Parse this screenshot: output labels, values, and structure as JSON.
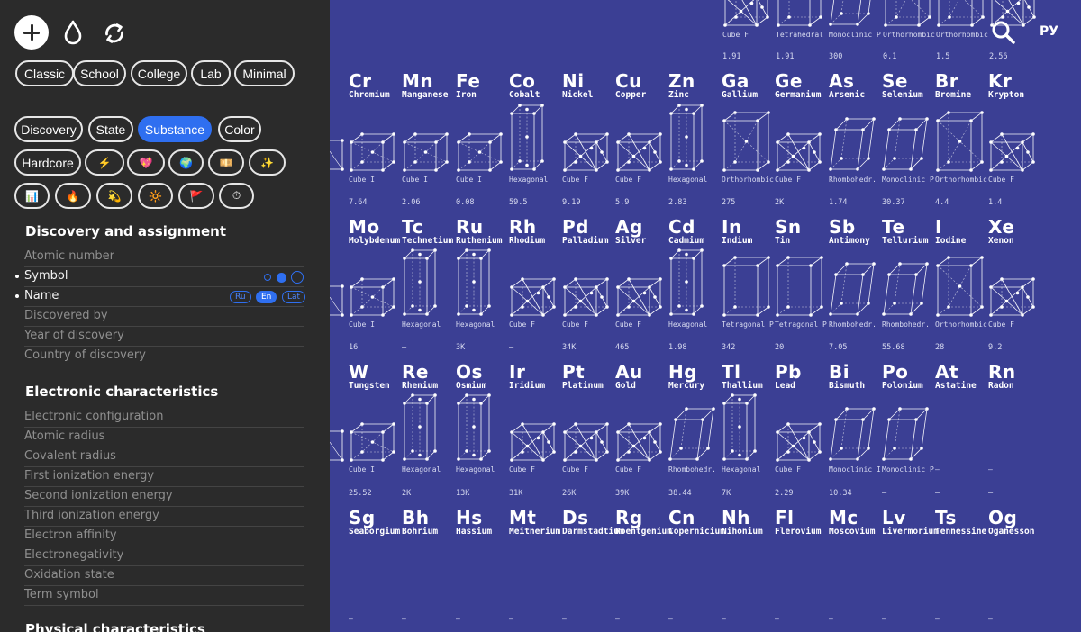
{
  "header": {
    "lang_toggle": "РУ"
  },
  "sidebar": {
    "presets": [
      {
        "label": "Classic",
        "active": false
      },
      {
        "label": "School",
        "active": false
      },
      {
        "label": "College",
        "active": false
      },
      {
        "label": "Lab",
        "active": false
      },
      {
        "label": "Minimal",
        "active": false
      },
      {
        "label": "Discovery",
        "active": false
      },
      {
        "label": "State",
        "active": false
      },
      {
        "label": "Substance",
        "active": true
      },
      {
        "label": "Color",
        "active": false
      },
      {
        "label": "Hardcore",
        "active": false
      },
      {
        "label": "⚡",
        "active": false
      },
      {
        "label": "💖",
        "active": false
      },
      {
        "label": "🌍",
        "active": false
      },
      {
        "label": "💴",
        "active": false
      },
      {
        "label": "✨",
        "active": false
      },
      {
        "label": "📊",
        "active": false
      },
      {
        "label": "🔥",
        "active": false
      },
      {
        "label": "💫",
        "active": false
      },
      {
        "label": "🔆",
        "active": false
      },
      {
        "label": "🚩",
        "active": false
      },
      {
        "label": "⏱",
        "active": false
      }
    ],
    "sections": [
      {
        "title": "Discovery and assignment",
        "options": [
          {
            "label": "Atomic number",
            "on": false
          },
          {
            "label": "Symbol",
            "on": true
          },
          {
            "label": "Name",
            "on": true
          },
          {
            "label": "Discovered by",
            "on": false
          },
          {
            "label": "Year of discovery",
            "on": false
          },
          {
            "label": "Country of discovery",
            "on": false
          }
        ]
      },
      {
        "title": "Electronic characteristics",
        "options": [
          {
            "label": "Electronic configuration",
            "on": false
          },
          {
            "label": "Atomic radius",
            "on": false
          },
          {
            "label": "Covalent radius",
            "on": false
          },
          {
            "label": "First ionization energy",
            "on": false
          },
          {
            "label": "Second ionization energy",
            "on": false
          },
          {
            "label": "Third ionization energy",
            "on": false
          },
          {
            "label": "Electron affinity",
            "on": false
          },
          {
            "label": "Electronegativity",
            "on": false
          },
          {
            "label": "Oxidation state",
            "on": false
          },
          {
            "label": "Term symbol",
            "on": false
          }
        ]
      },
      {
        "title": "Physical characteristics",
        "options": []
      }
    ],
    "name_langs": [
      {
        "label": "Ru",
        "active": false
      },
      {
        "label": "En",
        "active": true
      },
      {
        "label": "Lat",
        "active": false
      }
    ]
  },
  "table": {
    "row0": {
      "structures": [
        "Cube F",
        "Tetrahedral",
        "Monoclinic P",
        "Orthorhombic I",
        "Orthorhombic I",
        ""
      ],
      "values": [
        "1.91",
        "1.91",
        "300",
        "0.1",
        "1.5",
        "2.56"
      ]
    },
    "rows": [
      {
        "elements": [
          {
            "symbol": "Cr",
            "name": "Chromium"
          },
          {
            "symbol": "Mn",
            "name": "Manganese"
          },
          {
            "symbol": "Fe",
            "name": "Iron"
          },
          {
            "symbol": "Co",
            "name": "Cobalt"
          },
          {
            "symbol": "Ni",
            "name": "Nickel"
          },
          {
            "symbol": "Cu",
            "name": "Copper"
          },
          {
            "symbol": "Zn",
            "name": "Zinc"
          },
          {
            "symbol": "Ga",
            "name": "Gallium"
          },
          {
            "symbol": "Ge",
            "name": "Germanium"
          },
          {
            "symbol": "As",
            "name": "Arsenic"
          },
          {
            "symbol": "Se",
            "name": "Selenium"
          },
          {
            "symbol": "Br",
            "name": "Bromine"
          },
          {
            "symbol": "Kr",
            "name": "Krypton"
          }
        ],
        "structures": [
          "Cube I",
          "Cube I",
          "Cube I",
          "Hexagonal",
          "Cube F",
          "Cube F",
          "Hexagonal",
          "Orthorhombic I",
          "Cube F",
          "Rhombohedr.",
          "Monoclinic P",
          "Orthorhombic I",
          "Cube F"
        ],
        "values": [
          "7.64",
          "2.06",
          "0.08",
          "59.5",
          "9.19",
          "5.9",
          "2.83",
          "275",
          "2K",
          "1.74",
          "30.37",
          "4.4",
          "1.4"
        ]
      },
      {
        "elements": [
          {
            "symbol": "Mo",
            "name": "Molybdenum"
          },
          {
            "symbol": "Tc",
            "name": "Technetium"
          },
          {
            "symbol": "Ru",
            "name": "Ruthenium"
          },
          {
            "symbol": "Rh",
            "name": "Rhodium"
          },
          {
            "symbol": "Pd",
            "name": "Palladium"
          },
          {
            "symbol": "Ag",
            "name": "Silver"
          },
          {
            "symbol": "Cd",
            "name": "Cadmium"
          },
          {
            "symbol": "In",
            "name": "Indium"
          },
          {
            "symbol": "Sn",
            "name": "Tin"
          },
          {
            "symbol": "Sb",
            "name": "Antimony"
          },
          {
            "symbol": "Te",
            "name": "Tellurium"
          },
          {
            "symbol": "I",
            "name": "Iodine"
          },
          {
            "symbol": "Xe",
            "name": "Xenon"
          }
        ],
        "structures": [
          "Cube I",
          "Hexagonal",
          "Hexagonal",
          "Cube F",
          "Cube F",
          "Cube F",
          "Hexagonal",
          "Tetragonal P",
          "Tetragonal P",
          "Rhombohedr.",
          "Rhombohedr.",
          "Orthorhombic I",
          "Cube F"
        ],
        "values": [
          "16",
          "—",
          "3K",
          "—",
          "34K",
          "465",
          "1.98",
          "342",
          "20",
          "7.05",
          "55.68",
          "28",
          "9.2"
        ]
      },
      {
        "elements": [
          {
            "symbol": "W",
            "name": "Tungsten"
          },
          {
            "symbol": "Re",
            "name": "Rhenium"
          },
          {
            "symbol": "Os",
            "name": "Osmium"
          },
          {
            "symbol": "Ir",
            "name": "Iridium"
          },
          {
            "symbol": "Pt",
            "name": "Platinum"
          },
          {
            "symbol": "Au",
            "name": "Gold"
          },
          {
            "symbol": "Hg",
            "name": "Mercury"
          },
          {
            "symbol": "Tl",
            "name": "Thallium"
          },
          {
            "symbol": "Pb",
            "name": "Lead"
          },
          {
            "symbol": "Bi",
            "name": "Bismuth"
          },
          {
            "symbol": "Po",
            "name": "Polonium"
          },
          {
            "symbol": "At",
            "name": "Astatine"
          },
          {
            "symbol": "Rn",
            "name": "Radon"
          }
        ],
        "structures": [
          "Cube I",
          "Hexagonal",
          "Hexagonal",
          "Cube F",
          "Cube F",
          "Cube F",
          "Rhombohedr.",
          "Hexagonal",
          "Cube F",
          "Monoclinic I",
          "Monoclinic P",
          "—",
          "—"
        ],
        "values": [
          "25.52",
          "2K",
          "13K",
          "31K",
          "26K",
          "39K",
          "38.44",
          "7K",
          "2.29",
          "10.34",
          "—",
          "—",
          "—"
        ]
      },
      {
        "elements": [
          {
            "symbol": "Sg",
            "name": "Seaborgium"
          },
          {
            "symbol": "Bh",
            "name": "Bohrium"
          },
          {
            "symbol": "Hs",
            "name": "Hassium"
          },
          {
            "symbol": "Mt",
            "name": "Meitnerium"
          },
          {
            "symbol": "Ds",
            "name": "Darmstadtium"
          },
          {
            "symbol": "Rg",
            "name": "Roentgenium"
          },
          {
            "symbol": "Cn",
            "name": "Copernicium"
          },
          {
            "symbol": "Nh",
            "name": "Nihonium"
          },
          {
            "symbol": "Fl",
            "name": "Flerovium"
          },
          {
            "symbol": "Mc",
            "name": "Moscovium"
          },
          {
            "symbol": "Lv",
            "name": "Livermorium"
          },
          {
            "symbol": "Ts",
            "name": "Tennessine"
          },
          {
            "symbol": "Og",
            "name": "Oganesson"
          }
        ],
        "structures": [
          "—",
          "—",
          "—",
          "—",
          "—",
          "—",
          "—",
          "—",
          "—",
          "—",
          "—",
          "—",
          "—"
        ],
        "values": []
      }
    ]
  }
}
